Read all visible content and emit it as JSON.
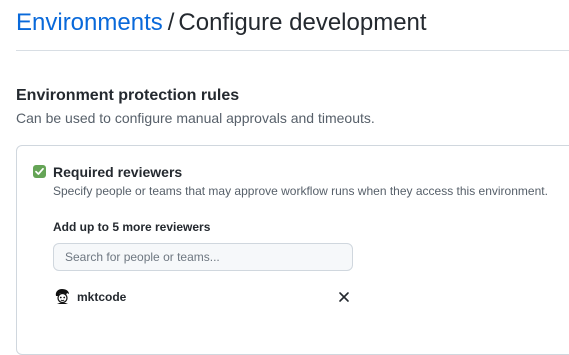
{
  "header": {
    "breadcrumb_link": "Environments",
    "separator": "/",
    "current_page": "Configure development"
  },
  "protection_rules": {
    "title": "Environment protection rules",
    "description": "Can be used to configure manual approvals and timeouts.",
    "required_reviewers": {
      "checked": true,
      "label": "Required reviewers",
      "help_text": "Specify people or teams that may approve workflow runs when they access this environment.",
      "add_more_label": "Add up to 5 more reviewers",
      "search_placeholder": "Search for people or teams...",
      "reviewers": [
        {
          "name": "mktcode",
          "avatar_icon": "user-avatar-icon"
        }
      ]
    }
  },
  "colors": {
    "link": "#0969da",
    "checkbox": "#65a456",
    "border": "#d0d7de",
    "muted_text": "#57606a"
  }
}
